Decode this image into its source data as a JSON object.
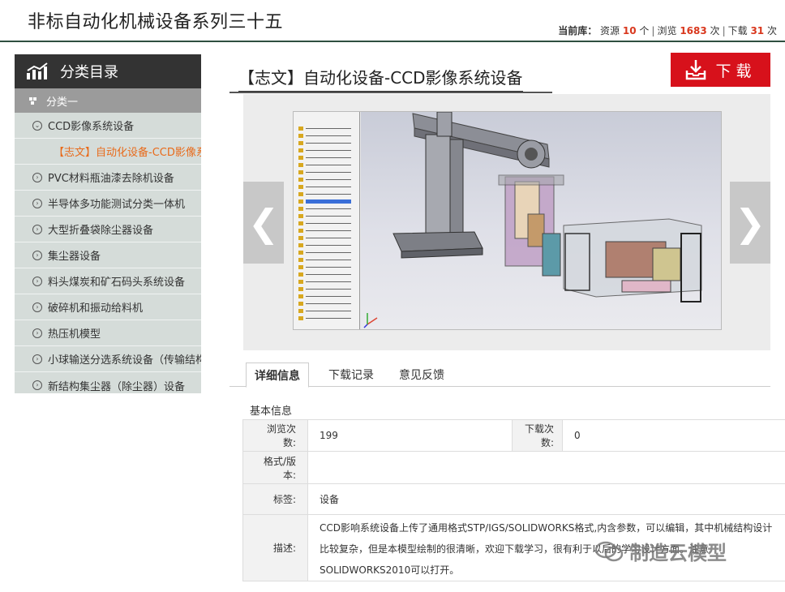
{
  "header": {
    "title": "非标自动化机械设备系列三十五",
    "stats": {
      "prefix": "当前库：",
      "resource_label": "资源",
      "resource_count": "10",
      "resource_unit": "个",
      "views_label": "浏览",
      "views_count": "1683",
      "views_unit": "次",
      "downloads_label": "下载",
      "downloads_count": "31",
      "downloads_unit": "次"
    }
  },
  "sidebar": {
    "title": "分类目录",
    "category": "分类一",
    "items": [
      {
        "label": "CCD影像系统设备",
        "icon": "chevron-down-circle-icon"
      },
      {
        "label": "【志文】自动化设备-CCD影像系统设备"
      },
      {
        "label": "PVC材料瓶油漆去除机设备",
        "icon": "chevron-right-circle-icon"
      },
      {
        "label": "半导体多功能测试分类一体机",
        "icon": "chevron-right-circle-icon"
      },
      {
        "label": "大型折叠袋除尘器设备",
        "icon": "chevron-right-circle-icon"
      },
      {
        "label": "集尘器设备",
        "icon": "chevron-right-circle-icon"
      },
      {
        "label": "料头煤炭和矿石码头系统设备",
        "icon": "chevron-right-circle-icon"
      },
      {
        "label": "破碎机和振动给料机",
        "icon": "chevron-right-circle-icon"
      },
      {
        "label": "热压机模型",
        "icon": "chevron-right-circle-icon"
      },
      {
        "label": "小球输送分选系统设备（传输结构",
        "icon": "chevron-right-circle-icon"
      },
      {
        "label": "新结构集尘器（除尘器）设备",
        "icon": "chevron-right-circle-icon"
      }
    ]
  },
  "main": {
    "title": "【志文】自动化设备-CCD影像系统设备",
    "download_label": "下载",
    "prev_arrow": "❮",
    "next_arrow": "❯",
    "tabs": [
      {
        "label": "详细信息"
      },
      {
        "label": "下载记录"
      },
      {
        "label": "意见反馈"
      }
    ],
    "section_label": "基本信息",
    "info": {
      "views_key": "浏览次数:",
      "views_value": "199",
      "downloads_key": "下载次数:",
      "downloads_value": "0",
      "format_key": "格式/版本:",
      "format_value": "",
      "tags_key": "标签:",
      "tags_value": "设备",
      "desc_key": "描述:",
      "desc_value": "CCD影响系统设备上传了通用格式STP/IGS/SOLIDWORKS格式,内含参数，可以编辑，其中机械结构设计比较复杂，但是本模型绘制的很清晰，欢迎下载学习，很有利于以后的学习设计方面。注意SOLIDWORKS2010可以打开。"
    }
  },
  "watermark": {
    "text": "制造云模型"
  },
  "colors": {
    "accent_red": "#d7111b",
    "stat_number": "#d9381e",
    "active_item": "#e86a1a",
    "sidebar_bg": "#d5dcd9",
    "sidebar_header": "#333333"
  }
}
